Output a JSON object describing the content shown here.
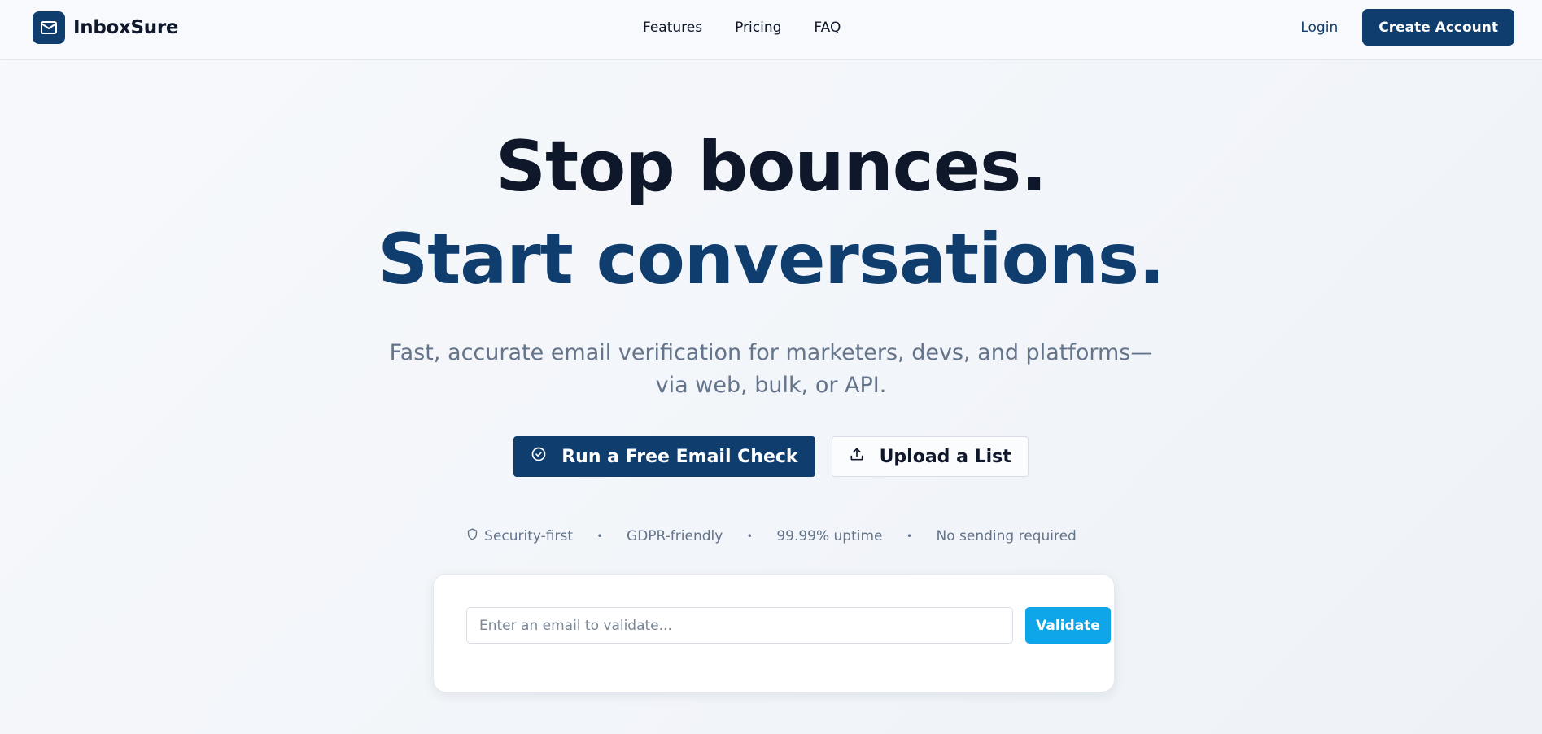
{
  "nav": {
    "brand": "InboxSure",
    "links": [
      {
        "label": "Features"
      },
      {
        "label": "Pricing"
      },
      {
        "label": "FAQ"
      }
    ],
    "login_label": "Login",
    "create_account_label": "Create Account"
  },
  "hero": {
    "headline_line1": "Stop bounces.",
    "headline_line2": "Start conversations.",
    "subtitle": "Fast, accurate email verification for marketers, devs, and platforms—via web, bulk, or API.",
    "primary_cta": "Run a Free Email Check",
    "secondary_cta": "Upload a List"
  },
  "trust": {
    "items": [
      "Security-first",
      "GDPR-friendly",
      "99.99% uptime",
      "No sending required"
    ],
    "separator": "•"
  },
  "validator": {
    "input_value": "",
    "placeholder": "Enter an email to validate...",
    "button_label": "Validate"
  },
  "icons": {
    "logo": "mail-icon",
    "primary_cta": "check-circle-icon",
    "secondary_cta": "upload-icon",
    "trust_first": "shield-icon"
  },
  "colors": {
    "brand_navy": "#0f3d6e",
    "accent_sky": "#0ea5e9",
    "text_dark": "#0f172a",
    "text_muted": "#64748b"
  }
}
